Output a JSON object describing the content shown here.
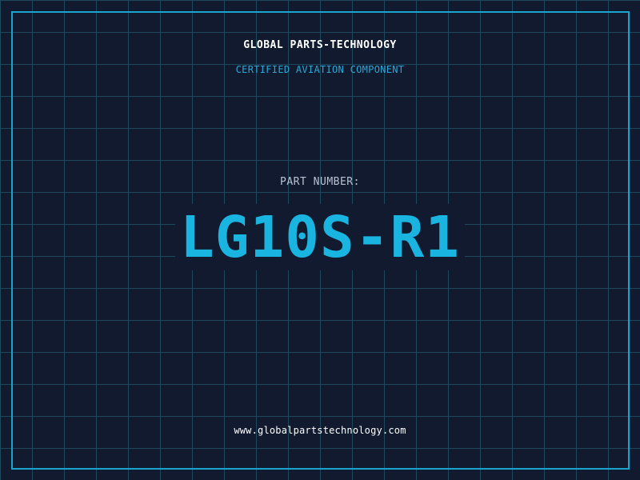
{
  "header": {
    "brand": "GLOBAL PARTS-TECHNOLOGY",
    "subtitle": "CERTIFIED AVIATION COMPONENT"
  },
  "part": {
    "label": "PART NUMBER:",
    "number": "LG10S-R1"
  },
  "footer": {
    "website": "www.globalpartstechnology.com"
  },
  "colors": {
    "background": "#111a2e",
    "grid": "#1c4a5c",
    "frame": "#1aa3cc",
    "accent": "#1ab4e0",
    "subtitle": "#2aa8d8",
    "label": "#b8c4d4",
    "text": "#ffffff"
  }
}
